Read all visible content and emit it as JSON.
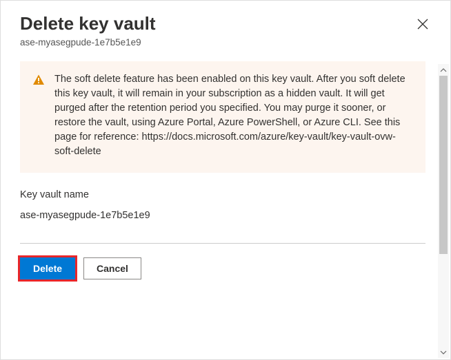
{
  "header": {
    "title": "Delete key vault",
    "subtitle": "ase-myasegpude-1e7b5e1e9"
  },
  "warning": {
    "icon": "warning-triangle-icon",
    "text": "The soft delete feature has been enabled on this key vault. After you soft delete this key vault, it will remain in your subscription as a hidden vault. It will get purged after the retention period you specified. You may purge it sooner, or restore the vault, using Azure Portal, Azure PowerShell, or Azure CLI. See this page for reference: https://docs.microsoft.com/azure/key-vault/key-vault-ovw-soft-delete"
  },
  "field": {
    "label": "Key vault name",
    "value": "ase-myasegpude-1e7b5e1e9"
  },
  "footer": {
    "delete_label": "Delete",
    "cancel_label": "Cancel"
  },
  "colors": {
    "primary": "#0078d4",
    "warning_bg": "#fdf5ef",
    "warning_icon": "#e08a00",
    "highlight": "#e8262a"
  }
}
